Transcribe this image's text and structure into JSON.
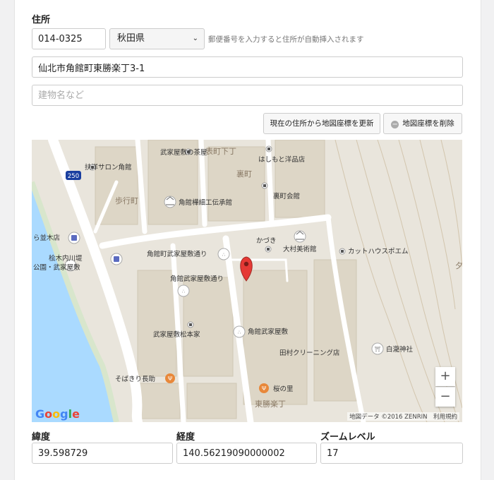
{
  "address": {
    "label": "住所",
    "postal_code": "014-0325",
    "prefecture": "秋田県",
    "postal_hint": "郵便番号を入力すると住所が自動挿入されます",
    "address_line": "仙北市角館町東勝楽丁3-1",
    "building_placeholder": "建物名など"
  },
  "buttons": {
    "update_coords": "現在の住所から地図座標を更新",
    "delete_coords": "地図座標を削除"
  },
  "map": {
    "labels": {
      "l1": "武家屋敷の茶屋",
      "l2": "表町下丁",
      "l3": "扶洋サロン角館",
      "l4": "はしもと洋品店",
      "l5": "裏町",
      "l6": "250",
      "l7": "歩行町",
      "l8": "角館樺細工伝承館",
      "l9": "裏町会館",
      "l10": "ら並木店",
      "l11": "かづき",
      "l12": "大村美術館",
      "l13": "角館町武家屋敷通り",
      "l14": "カットハウスポエム",
      "l15": "桧木内川堤",
      "l16": "公園・武家屋敷",
      "l17": "角館武家屋敷通り",
      "l18": "武家屋敷松本家",
      "l19": "角館武家屋敷",
      "l20": "田村クリーニング店",
      "l21": "白瀧神社",
      "l22": "そばきり長助",
      "l23": "桜の里",
      "l24": "東勝楽丁",
      "l25": "夕"
    },
    "attribution": "地図データ ©2016 ZENRIN　利用規約",
    "zoom_in": "+",
    "zoom_out": "−"
  },
  "coords": {
    "lat_label": "緯度",
    "lat": "39.598729",
    "lng_label": "経度",
    "lng": "140.56219090000002",
    "zoom_label": "ズームレベル",
    "zoom": "17"
  }
}
